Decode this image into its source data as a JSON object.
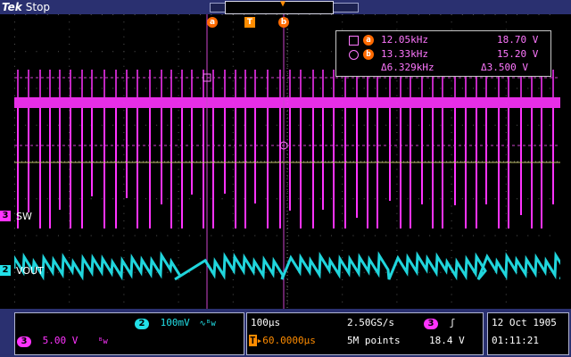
{
  "header": {
    "brand": "Tek",
    "state": "Stop"
  },
  "cursors": {
    "a_label": "a",
    "b_label": "b",
    "trigger_label": "T"
  },
  "measurements": {
    "row_a": {
      "freq": "12.05kHz",
      "volt": "18.70 V"
    },
    "row_b": {
      "freq": "13.33kHz",
      "volt": "15.20 V"
    },
    "delta": {
      "freq": "Δ6.329kHz",
      "volt": "Δ3.500 V"
    }
  },
  "channels": [
    {
      "number": "3",
      "name": "SW",
      "color": "#ff33ff"
    },
    {
      "number": "2",
      "name": "VOUT",
      "color": "#22e0e8"
    }
  ],
  "bottom": {
    "ch2": {
      "number": "2",
      "scale": "100mV",
      "coupling_icon": "bandwidth-limit-icon"
    },
    "ch3": {
      "number": "3",
      "scale": "5.00 V",
      "coupling_icon": "bandwidth-limit-icon"
    },
    "timebase": {
      "per_div": "100µs",
      "sample_rate": "2.50GS/s",
      "delay": "60.0000µs",
      "record": "5M points"
    },
    "trigger": {
      "source": "3",
      "slope_icon": "rising-edge-icon",
      "level": "18.4 V"
    },
    "date": {
      "date": "12 Oct  1905",
      "time": "01:11:21"
    }
  }
}
